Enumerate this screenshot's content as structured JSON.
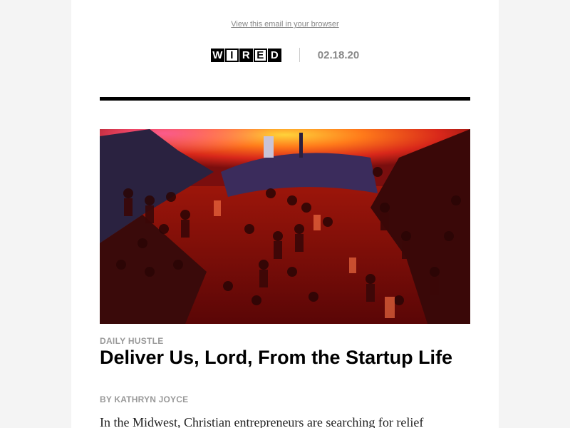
{
  "header": {
    "browser_link": "View this email in your browser",
    "logo_letters": [
      "W",
      "I",
      "R",
      "E",
      "D"
    ],
    "date": "02.18.20"
  },
  "article": {
    "kicker": "DAILY HUSTLE",
    "headline": "Deliver Us, Lord, From the Startup Life",
    "byline": "BY KATHRYN JOYCE",
    "dek": "In the Midwest, Christian entrepreneurs are searching for relief"
  },
  "colors": {
    "background": "#f4f4f4",
    "email_background": "#ffffff",
    "muted_text": "#999999",
    "rule": "#000000",
    "hero_red": "#c8210a"
  }
}
